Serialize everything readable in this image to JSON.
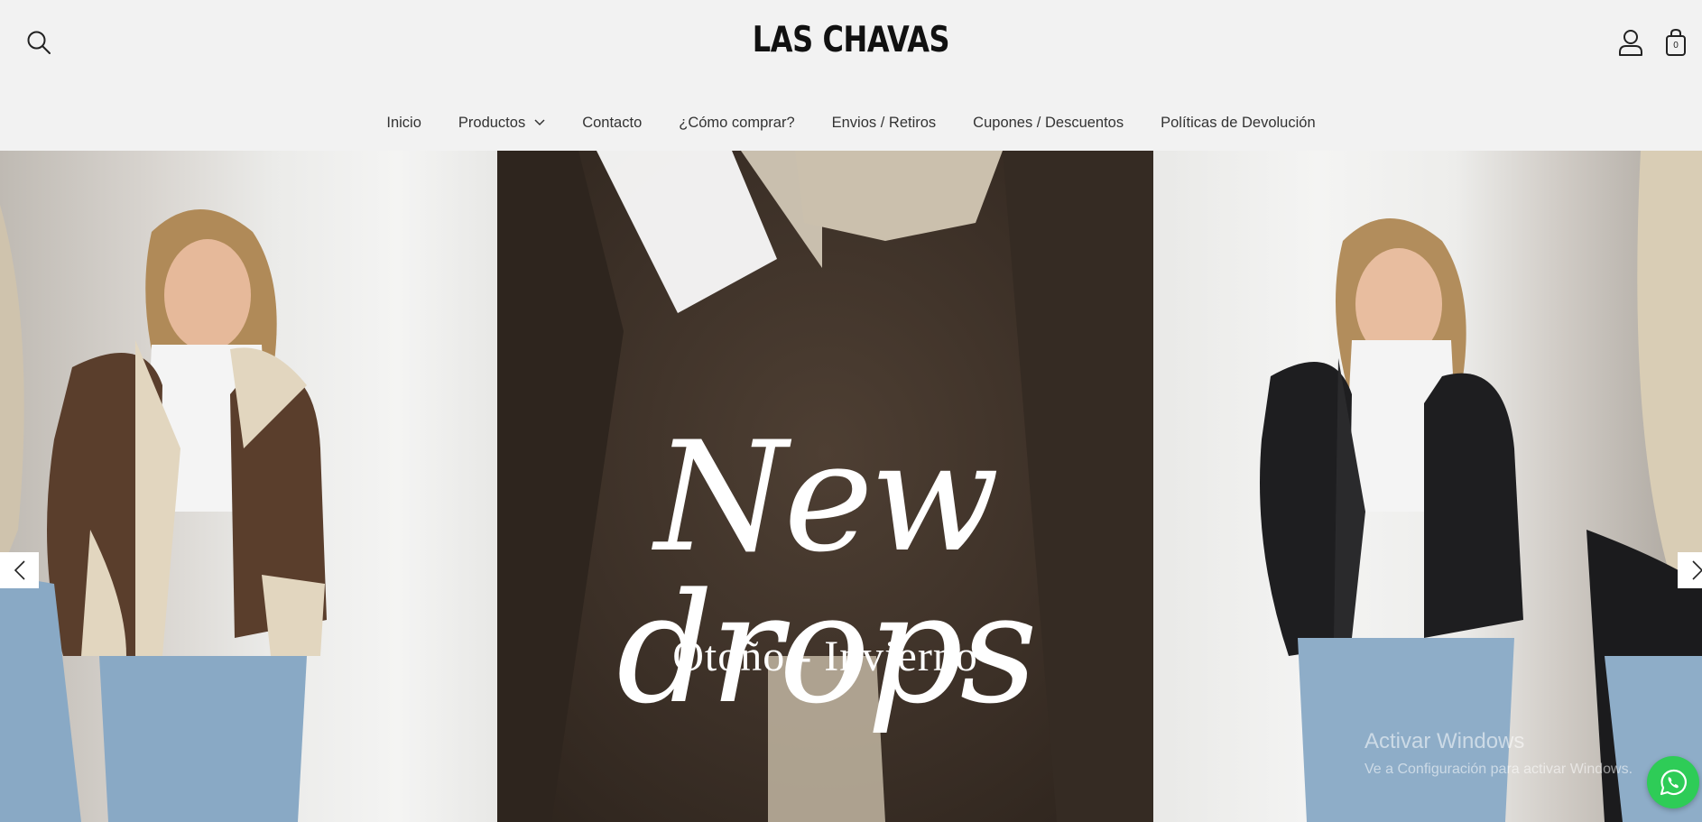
{
  "header": {
    "brand": "LAS CHAVAS",
    "search_icon": "search-icon",
    "account_icon": "user-icon",
    "cart_icon": "shopping-bag-icon",
    "cart_count": "0"
  },
  "nav": {
    "items": [
      {
        "label": "Inicio"
      },
      {
        "label": "Productos",
        "has_dropdown": true
      },
      {
        "label": "Contacto"
      },
      {
        "label": "¿Cómo comprar?"
      },
      {
        "label": "Envios / Retiros"
      },
      {
        "label": "Cupones / Descuentos"
      },
      {
        "label": "Políticas de Devolución"
      }
    ]
  },
  "hero": {
    "title": "New drops",
    "subtitle": "Otoño - Invierno",
    "prev_icon": "chevron-left-icon",
    "next_icon": "chevron-right-icon"
  },
  "overlay": {
    "watermark_title": "Activar Windows",
    "watermark_text": "Ve a Configuración para activar Windows.",
    "whatsapp_icon": "whatsapp-icon",
    "whatsapp_color": "#2ecc57"
  }
}
